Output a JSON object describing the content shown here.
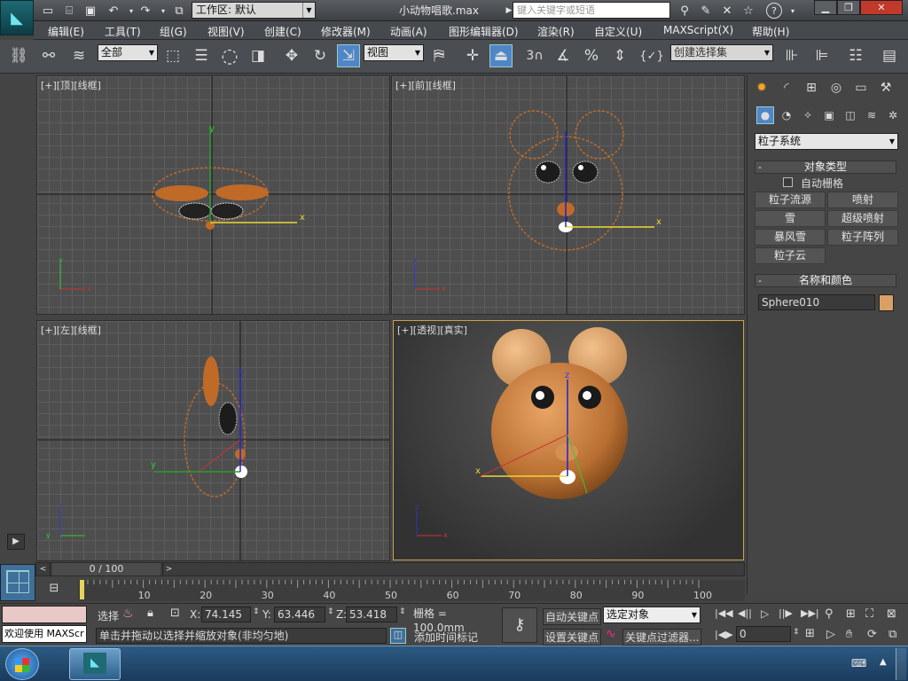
{
  "titlebar": {
    "workspace_label": "工作区: 默认",
    "doc_title": "小动物唱歌.max",
    "search_placeholder": "键入关键字或短语",
    "help_label": "?"
  },
  "menu": [
    "编辑(E)",
    "工具(T)",
    "组(G)",
    "视图(V)",
    "创建(C)",
    "修改器(M)",
    "动画(A)",
    "图形编辑器(D)",
    "渲染(R)",
    "自定义(U)",
    "MAXScript(X)",
    "帮助(H)"
  ],
  "toolbar": {
    "selection_filter": "全部",
    "ref_coord": "视图",
    "snap_3": "3",
    "named_selection_placeholder": "创建选择集"
  },
  "viewports": {
    "top": "[+][顶][线框]",
    "front": "[+][前][线框]",
    "left": "[+][左][线框]",
    "persp": "[+][透视][真实]"
  },
  "command_panel": {
    "category": "粒子系统",
    "object_type_title": "对象类型",
    "auto_grid": "自动栅格",
    "buttons": [
      "粒子流源",
      "喷射",
      "雪",
      "超级喷射",
      "暴风雪",
      "粒子阵列",
      "粒子云"
    ],
    "name_color_title": "名称和颜色",
    "object_name": "Sphere010",
    "object_color": "#d9a066"
  },
  "timeline": {
    "frame_display": "0 / 100",
    "ticks": [
      "10",
      "20",
      "30",
      "40",
      "50",
      "60",
      "70",
      "80",
      "90",
      "100"
    ]
  },
  "status": {
    "maxscript_listener": "欢迎使用 MAXScr",
    "selection_label": "选择",
    "x_label": "X:",
    "x_value": "74.145",
    "y_label": "Y:",
    "y_value": "63.446",
    "z_label": "Z:",
    "z_value": "53.418",
    "grid": "栅格 = 100.0mm",
    "prompt": "单击并拖动以选择并缩放对象(非均匀地)",
    "add_time_tag": "添加时间标记",
    "auto_key": "自动关键点",
    "set_key": "设置关键点",
    "key_mode": "选定对象",
    "key_filters": "关键点过滤器...",
    "current_frame": "0"
  },
  "colors": {
    "accent_active": "#4f86c6",
    "model_orange": "#c87a3a",
    "persp_border": "#c9a14a"
  }
}
